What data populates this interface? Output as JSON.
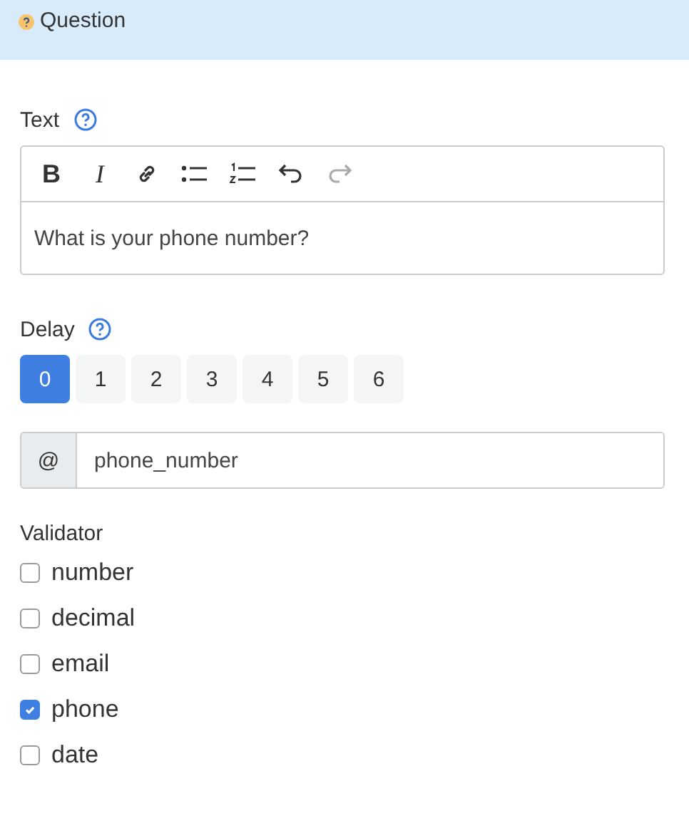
{
  "header": {
    "title": "Question"
  },
  "text_field": {
    "label": "Text",
    "toolbar": [
      {
        "kind": "bold",
        "glyph": "B",
        "disabled": false
      },
      {
        "kind": "italic",
        "glyph": "I",
        "disabled": false
      },
      {
        "kind": "link",
        "disabled": false
      },
      {
        "kind": "bullets",
        "disabled": false
      },
      {
        "kind": "numbered",
        "disabled": false
      },
      {
        "kind": "undo",
        "disabled": false
      },
      {
        "kind": "redo",
        "disabled": true
      }
    ],
    "value": "What is your phone number?"
  },
  "delay": {
    "label": "Delay",
    "options": [
      {
        "label": "0",
        "selected": true
      },
      {
        "label": "1",
        "selected": false
      },
      {
        "label": "2",
        "selected": false
      },
      {
        "label": "3",
        "selected": false
      },
      {
        "label": "4",
        "selected": false
      },
      {
        "label": "5",
        "selected": false
      },
      {
        "label": "6",
        "selected": false
      }
    ]
  },
  "variable": {
    "prefix": "@",
    "value": "phone_number"
  },
  "validator": {
    "label": "Validator",
    "options": [
      {
        "label": "number",
        "checked": false
      },
      {
        "label": "decimal",
        "checked": false
      },
      {
        "label": "email",
        "checked": false
      },
      {
        "label": "phone",
        "checked": true
      },
      {
        "label": "date",
        "checked": false
      }
    ]
  }
}
